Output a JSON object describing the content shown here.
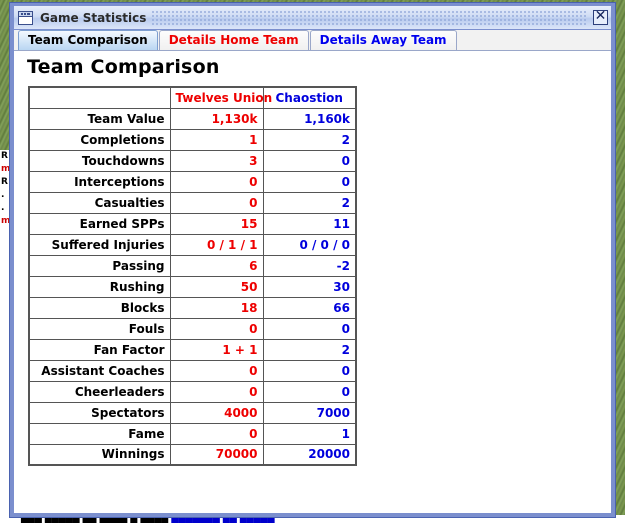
{
  "window": {
    "title": "Game Statistics",
    "icon": "window-icon",
    "close_label": "☒"
  },
  "tabs": [
    {
      "label": "Team Comparison",
      "color": "black",
      "selected": true
    },
    {
      "label": "Details Home Team",
      "color": "red",
      "selected": false
    },
    {
      "label": "Details Away Team",
      "color": "blue",
      "selected": false
    }
  ],
  "page": {
    "heading": "Team Comparison"
  },
  "colors": {
    "home_team": "#ee0000",
    "away_team": "#0000dd",
    "title_bar": "#b9cbee",
    "selected_tab": "#b9d6f2"
  },
  "table": {
    "corner_header": "",
    "home_header": "Twelves Union",
    "away_header": "Chaostion",
    "rows": [
      {
        "label": "Team Value",
        "home": "1,130k",
        "away": "1,160k"
      },
      {
        "label": "Completions",
        "home": "1",
        "away": "2"
      },
      {
        "label": "Touchdowns",
        "home": "3",
        "away": "0"
      },
      {
        "label": "Interceptions",
        "home": "0",
        "away": "0"
      },
      {
        "label": "Casualties",
        "home": "0",
        "away": "2"
      },
      {
        "label": "Earned SPPs",
        "home": "15",
        "away": "11"
      },
      {
        "label": "Suffered Injuries",
        "home": "0 / 1 / 1",
        "away": "0 / 0 / 0"
      },
      {
        "label": "Passing",
        "home": "6",
        "away": "-2"
      },
      {
        "label": "Rushing",
        "home": "50",
        "away": "30"
      },
      {
        "label": "Blocks",
        "home": "18",
        "away": "66"
      },
      {
        "label": "Fouls",
        "home": "0",
        "away": "0"
      },
      {
        "label": "Fan Factor",
        "home": "1 + 1",
        "away": "2"
      },
      {
        "label": "Assistant Coaches",
        "home": "0",
        "away": "0"
      },
      {
        "label": "Cheerleaders",
        "home": "0",
        "away": "0"
      },
      {
        "label": "Spectators",
        "home": "4000",
        "away": "7000"
      },
      {
        "label": "Fame",
        "home": "0",
        "away": "1"
      },
      {
        "label": "Winnings",
        "home": "70000",
        "away": "20000"
      }
    ]
  },
  "background": {
    "left_fragments": [
      "R",
      "m",
      "R",
      ".",
      ".",
      "m"
    ],
    "bottom_fragment": "███ █████ ██ ████ █ ████",
    "bottom_fragment_blue": "███████ ██ █████"
  }
}
